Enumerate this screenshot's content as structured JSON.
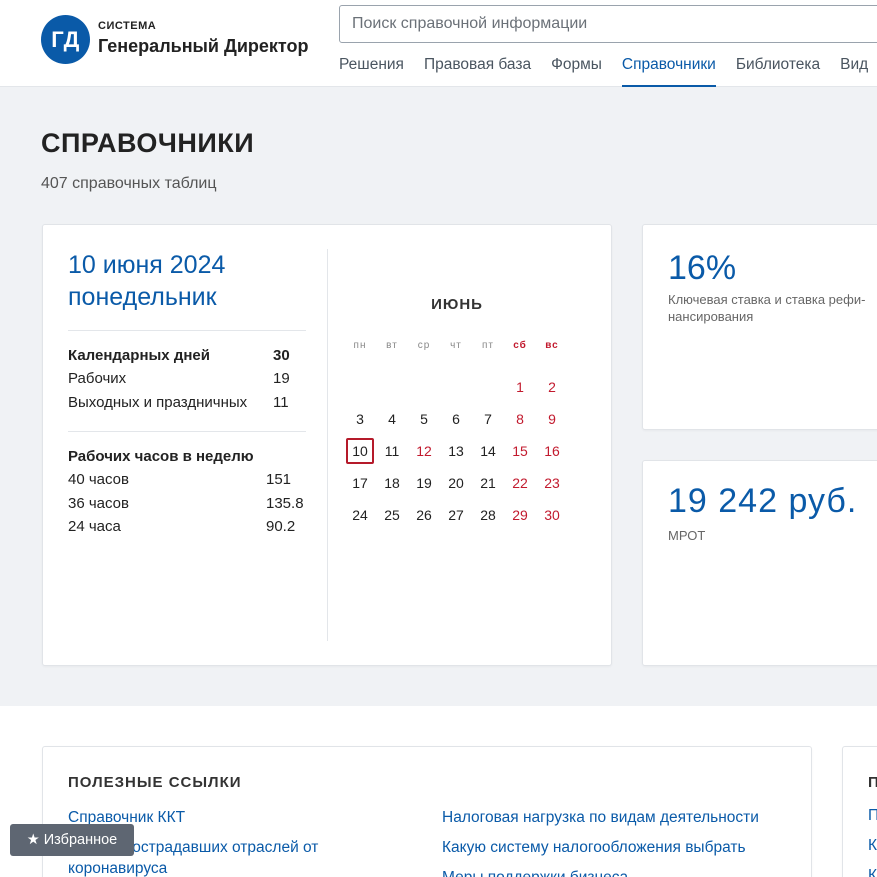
{
  "header": {
    "logo_badge": "ГД",
    "logo_small": "СИСТЕМА",
    "logo_main": "Генеральный Директор",
    "search_placeholder": "Поиск справочной информации",
    "nav": [
      {
        "label": "Решения",
        "active": false
      },
      {
        "label": "Правовая база",
        "active": false
      },
      {
        "label": "Формы",
        "active": false
      },
      {
        "label": "Справочники",
        "active": true
      },
      {
        "label": "Библиотека",
        "active": false
      },
      {
        "label": "Вид",
        "active": false
      }
    ]
  },
  "page": {
    "title": "СПРАВОЧНИКИ",
    "subtitle": "407 справочных таблиц"
  },
  "calendar_card": {
    "date": "10 июня 2024",
    "weekday": "понедельник",
    "days": [
      {
        "label": "Календарных дней",
        "value": "30",
        "bold": true
      },
      {
        "label": "Рабочих",
        "value": "19",
        "bold": false
      },
      {
        "label": "Выходных и праздничных",
        "value": "11",
        "bold": false
      }
    ],
    "hours_title": "Рабочих часов в неделю",
    "hours": [
      {
        "label": "40 часов",
        "value": "151"
      },
      {
        "label": "36 часов",
        "value": "135.8"
      },
      {
        "label": "24 часа",
        "value": "90.2"
      }
    ],
    "month": "ИЮНЬ",
    "weekdays": [
      "пн",
      "вт",
      "ср",
      "чт",
      "пт",
      "сб",
      "вс"
    ],
    "weeks": [
      [
        "",
        "",
        "",
        "",
        "",
        "1",
        "2"
      ],
      [
        "3",
        "4",
        "5",
        "6",
        "7",
        "8",
        "9"
      ],
      [
        "10",
        "11",
        "12",
        "13",
        "14",
        "15",
        "16"
      ],
      [
        "17",
        "18",
        "19",
        "20",
        "21",
        "22",
        "23"
      ],
      [
        "24",
        "25",
        "26",
        "27",
        "28",
        "29",
        "30"
      ]
    ],
    "holidays": [
      "1",
      "2",
      "8",
      "9",
      "12",
      "15",
      "16",
      "22",
      "23",
      "29",
      "30"
    ],
    "today": "10"
  },
  "key_rate": {
    "value": "16%",
    "label": "Ключевая ставка и ставка рефи-нансирования"
  },
  "mrot": {
    "value": "19 242 руб.",
    "label": "МРОТ"
  },
  "links": {
    "title": "ПОЛЕЗНЫЕ ССЫЛКИ",
    "left": [
      "Справочник ККТ",
      "Список пострадавших отраслей от коронавируса"
    ],
    "right": [
      "Налоговая нагрузка по видам деятельности",
      "Какую систему налогообложения выбрать",
      "Меры поддержки бизнеса"
    ]
  },
  "right_card": {
    "title": "П",
    "items": [
      "П",
      "К",
      "К"
    ]
  },
  "favorites": {
    "label": "Избранное"
  },
  "colors": {
    "brand": "#0a5aa8",
    "holiday": "#c21a2e",
    "band": "#f0f2f5"
  }
}
